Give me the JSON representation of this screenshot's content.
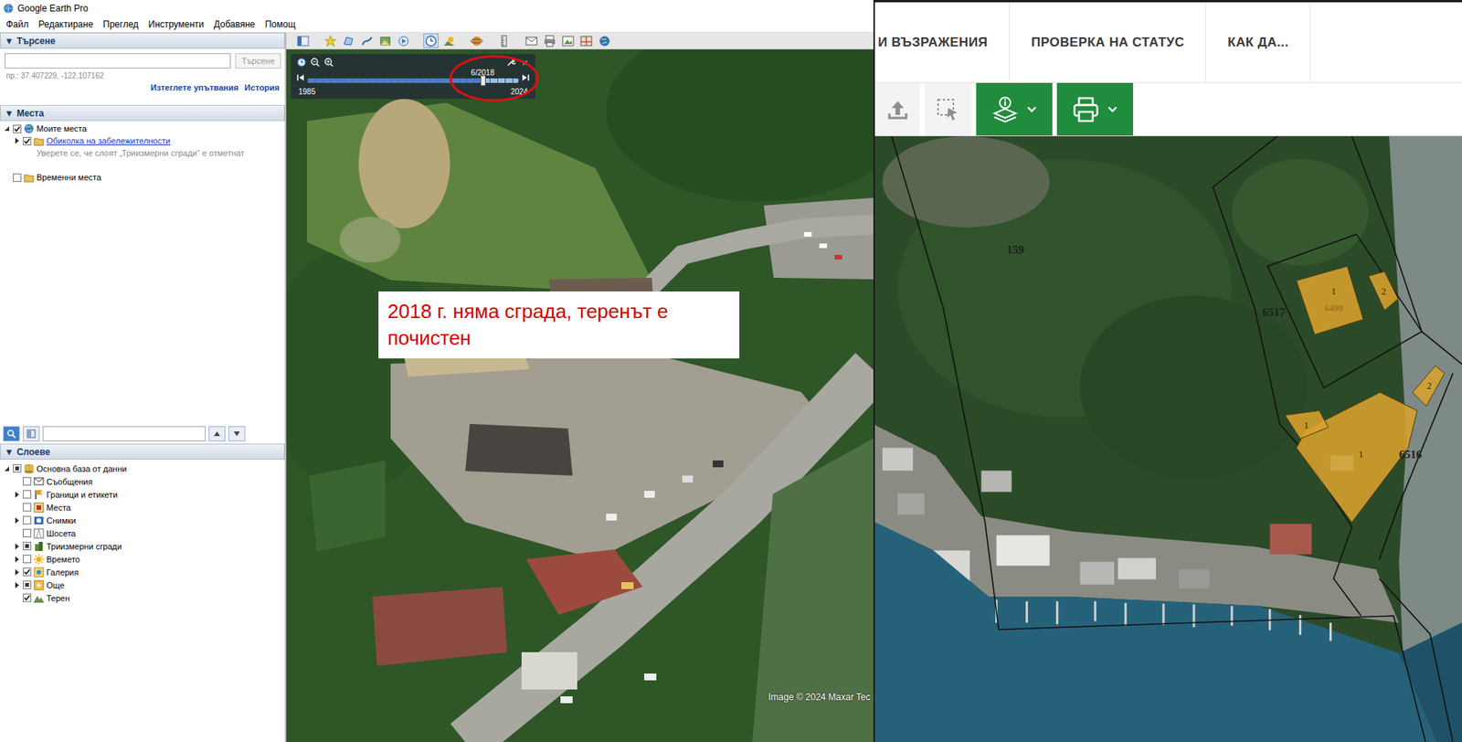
{
  "window": {
    "title": "Google Earth Pro"
  },
  "menu": [
    "Файл",
    "Редактиране",
    "Преглед",
    "Инструменти",
    "Добавяне",
    "Помощ"
  ],
  "search_panel": {
    "toggle": "▼",
    "title": "Търсене",
    "query": "",
    "button": {
      "label": "Търсене",
      "disabled": true
    },
    "hint": "пр.: 37.407229, -122.107162",
    "links": [
      "Изтеглете упътвания",
      "История"
    ]
  },
  "places": {
    "toggle": "▼",
    "title": "Места",
    "items": [
      {
        "label": "Моите места",
        "depth": 0,
        "kind": "item",
        "checked": true,
        "expandable": true,
        "expanded": true
      },
      {
        "label": "Обиколка на забележителности",
        "depth": 1,
        "kind": "link",
        "checked": true,
        "expandable": true,
        "expanded": false
      },
      {
        "label": "Уверете се, че слоят „Триизмерни сгради“ е отметнат",
        "depth": 2,
        "kind": "note"
      },
      {
        "label": "Временни места",
        "depth": 0,
        "kind": "item",
        "checked": false,
        "expandable": false,
        "expanded": false
      }
    ]
  },
  "layer_search": {
    "query": ""
  },
  "layers": {
    "toggle": "▼",
    "title": "Слоеве",
    "items": [
      {
        "label": "Основна база от данни",
        "depth": 0,
        "checked": false,
        "partial": true,
        "expandable": true,
        "expanded": true
      },
      {
        "label": "Съобщения",
        "depth": 1,
        "checked": false,
        "partial": false,
        "expandable": false,
        "expanded": false
      },
      {
        "label": "Граници и етикети",
        "depth": 1,
        "checked": false,
        "partial": false,
        "expandable": true,
        "expanded": false
      },
      {
        "label": "Места",
        "depth": 1,
        "checked": false,
        "partial": false,
        "expandable": false,
        "expanded": false
      },
      {
        "label": "Снимки",
        "depth": 1,
        "checked": false,
        "partial": false,
        "expandable": true,
        "expanded": false
      },
      {
        "label": "Шосета",
        "depth": 1,
        "checked": false,
        "partial": false,
        "expandable": false,
        "expanded": false
      },
      {
        "label": "Триизмерни сгради",
        "depth": 1,
        "checked": false,
        "partial": true,
        "expandable": true,
        "expanded": false
      },
      {
        "label": "Времето",
        "depth": 1,
        "checked": false,
        "partial": false,
        "expandable": true,
        "expanded": false
      },
      {
        "label": "Галерия",
        "depth": 1,
        "checked": true,
        "partial": false,
        "expandable": true,
        "expanded": false
      },
      {
        "label": "Още",
        "depth": 1,
        "checked": false,
        "partial": true,
        "expandable": true,
        "expanded": false
      },
      {
        "label": "Терен",
        "depth": 1,
        "checked": true,
        "partial": false,
        "expandable": false,
        "expanded": false
      }
    ]
  },
  "map_toolbar": {
    "historical_imagery_on": true
  },
  "time_slider": {
    "date": "6/2018",
    "start": "1985",
    "end": "2024",
    "level": 0.83,
    "close": "×"
  },
  "annotation": {
    "text": "2018 г. няма сграда, теренът е почистен"
  },
  "credit": "Image © 2024 Maxar Tec",
  "cadastre": {
    "nav": [
      {
        "label": "И ВЪЗРАЖЕНИЯ"
      },
      {
        "label": "ПРОВЕРКА НА СТАТУС"
      },
      {
        "label": "КАК ДА..."
      }
    ],
    "parcels": [
      {
        "label": "159"
      },
      {
        "label": "6517"
      },
      {
        "label": "6516"
      }
    ],
    "buildings": [
      {
        "labels": [
          "1",
          "6499"
        ]
      },
      {
        "labels": [
          "2"
        ]
      },
      {
        "labels": [
          "2"
        ]
      },
      {
        "labels": [
          "1"
        ]
      },
      {
        "labels": [
          "1"
        ]
      }
    ]
  }
}
